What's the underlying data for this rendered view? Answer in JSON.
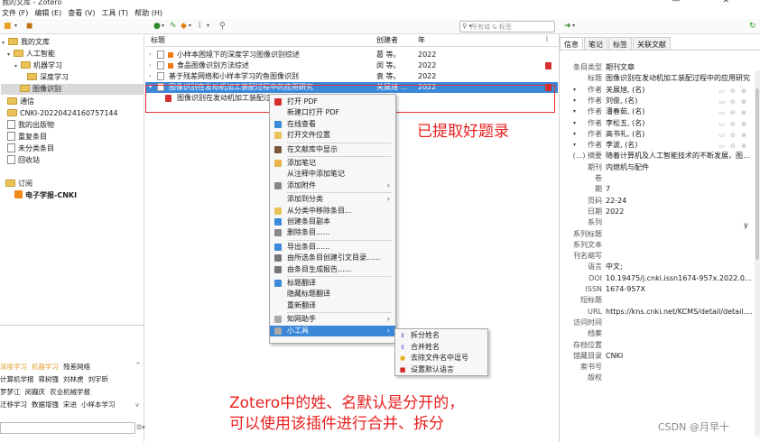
{
  "window": {
    "title": "我的文库 - Zotero",
    "controls": "— ✕"
  },
  "menubar": [
    "文件 (F)",
    "编辑 (E)",
    "查看 (V)",
    "工具 (T)",
    "帮助 (H)"
  ],
  "search": {
    "placeholder": "所有域 & 标签"
  },
  "left": {
    "library": "我的文库",
    "folders": [
      {
        "label": "人工智能"
      },
      {
        "label": "机器学习"
      },
      {
        "label": "深度学习"
      },
      {
        "label": "图像识别"
      }
    ],
    "others": [
      "通信",
      "CNKI-20220424160757144",
      "我的出版物",
      "重复条目",
      "未分类条目",
      "回收站"
    ],
    "feeds_title": "订阅",
    "feed": "电子学报-CNKI",
    "tags": [
      [
        "深度学习",
        "机器学习",
        "残差网络"
      ],
      [
        "计算机学报",
        "蒋树强",
        "刘林虎",
        "刘宇昕"
      ],
      [
        "罗梦江",
        "闵巍庆",
        "农业机械学报"
      ],
      [
        "迁移学习",
        "数据增强",
        "宋进",
        "小样本学习"
      ]
    ]
  },
  "items": {
    "columns": {
      "title": "标题",
      "creator": "创建者",
      "year": "年"
    },
    "rows": [
      {
        "title": "小样本困境下的深度学习图像识别综述",
        "creator": "葛 等。",
        "year": "2022"
      },
      {
        "title": "食品图像识别方法综述",
        "creator": "闵 等。",
        "year": "2022"
      },
      {
        "title": "基于残差网络和小样本学习的鱼图像识别",
        "creator": "袁 等。",
        "year": "2022"
      },
      {
        "title": "图像识别在发动机加工装配过程中的应用研究",
        "creator": "关展旭 ...",
        "year": "2022"
      },
      {
        "title": "图像识别在发动机加工装配过",
        "creator": "",
        "year": ""
      }
    ]
  },
  "info": {
    "tabs": [
      "信息",
      "笔记",
      "标签",
      "关联文献"
    ],
    "fields": [
      {
        "label": "条目类型",
        "value": "期刊文章"
      },
      {
        "label": "标题",
        "value": "图像识别在发动机加工装配过程中的应用研究"
      },
      {
        "label": "作者",
        "value": "关展旭, (名)"
      },
      {
        "label": "作者",
        "value": "刘俊, (名)"
      },
      {
        "label": "作者",
        "value": "潘春茹, (名)"
      },
      {
        "label": "作者",
        "value": "李松五, (名)"
      },
      {
        "label": "作者",
        "value": "高书礼, (名)"
      },
      {
        "label": "作者",
        "value": "李波, (名)"
      },
      {
        "label": "(...) 摘要",
        "value": "随着计算机及人工智能技术的不断发展，图..."
      },
      {
        "label": "期刊",
        "value": "内燃机与配件"
      },
      {
        "label": "卷",
        "value": ""
      },
      {
        "label": "期",
        "value": "7"
      },
      {
        "label": "页码",
        "value": "22-24"
      },
      {
        "label": "日期",
        "value": "2022"
      },
      {
        "label": "系列",
        "value": ""
      },
      {
        "label": "系列标题",
        "value": ""
      },
      {
        "label": "系列文本",
        "value": ""
      },
      {
        "label": "刊名缩写",
        "value": ""
      },
      {
        "label": "语言",
        "value": "中文;"
      },
      {
        "label": "DOI",
        "value": "10.19475/j.cnki.issn1674-957x.2022.07.0..."
      },
      {
        "label": "ISSN",
        "value": "1674-957X"
      },
      {
        "label": "短标题",
        "value": ""
      },
      {
        "label": "URL",
        "value": "https://kns.cnki.net/KCMS/detail/detail...."
      },
      {
        "label": "访问时间",
        "value": ""
      },
      {
        "label": "档案",
        "value": ""
      },
      {
        "label": "存档位置",
        "value": ""
      },
      {
        "label": "馆藏目录",
        "value": "CNKI"
      },
      {
        "label": "索书号",
        "value": ""
      },
      {
        "label": "版权",
        "value": ""
      }
    ],
    "date_side": "y"
  },
  "context_menu": [
    {
      "label": "打开 PDF",
      "icon": "pdf-icon",
      "color": "#d32f2f",
      "sep_before": false,
      "arrow": false
    },
    {
      "label": "新建口打开 PDF",
      "icon": "",
      "color": "",
      "sep_before": false,
      "arrow": false
    },
    {
      "label": "在线查看",
      "icon": "globe-icon",
      "color": "#3b8ad8",
      "sep_before": false,
      "arrow": false
    },
    {
      "label": "打开文件位置",
      "icon": "folder-icon",
      "color": "#e9c35a",
      "sep_before": false,
      "arrow": false
    },
    {
      "label": "在文献库中显示",
      "icon": "library-icon",
      "color": "#7a5a3a",
      "sep_before": true,
      "arrow": false
    },
    {
      "label": "添加笔记",
      "icon": "note-icon",
      "color": "#e9b24a",
      "sep_before": true,
      "arrow": false
    },
    {
      "label": "从注释中添加笔记",
      "icon": "",
      "color": "",
      "sep_before": false,
      "arrow": false
    },
    {
      "label": "添加附件",
      "icon": "paperclip-icon",
      "color": "#888888",
      "sep_before": false,
      "arrow": true
    },
    {
      "label": "添加到分类",
      "icon": "",
      "color": "",
      "sep_before": true,
      "arrow": true
    },
    {
      "label": "从分类中移除条目...",
      "icon": "folder-remove-icon",
      "color": "#e9c35a",
      "sep_before": false,
      "arrow": false
    },
    {
      "label": "创建条目副本",
      "icon": "copy-icon",
      "color": "#3b8ad8",
      "sep_before": false,
      "arrow": false
    },
    {
      "label": "删除条目......",
      "icon": "trash-icon",
      "color": "#888888",
      "sep_before": false,
      "arrow": false
    },
    {
      "label": "导出条目......",
      "icon": "export-icon",
      "color": "#3b8ad8",
      "sep_before": true,
      "arrow": false
    },
    {
      "label": "由所选条目创建引文目录......",
      "icon": "citation-icon",
      "color": "#777777",
      "sep_before": false,
      "arrow": false
    },
    {
      "label": "由条目生成报告......",
      "icon": "report-icon",
      "color": "#777777",
      "sep_before": false,
      "arrow": false
    },
    {
      "label": "标题翻译",
      "icon": "translate-icon",
      "color": "#3b8ad8",
      "sep_before": true,
      "arrow": false
    },
    {
      "label": "隐藏标题翻译",
      "icon": "",
      "color": "",
      "sep_before": false,
      "arrow": false
    },
    {
      "label": "重新翻译",
      "icon": "",
      "color": "",
      "sep_before": false,
      "arrow": false
    },
    {
      "label": "知网助手",
      "icon": "wrench-icon",
      "color": "#aaaaaa",
      "sep_before": true,
      "arrow": true
    },
    {
      "label": "小工具",
      "icon": "tool-icon",
      "color": "#aaaaaa",
      "sep_before": false,
      "arrow": true
    }
  ],
  "submenu": [
    {
      "label": "拆分姓名",
      "icon": "split-icon",
      "glyph": "‡",
      "color": "#4a4ad8"
    },
    {
      "label": "合并姓名",
      "icon": "merge-icon",
      "glyph": "‡",
      "color": "#4a4ad8"
    },
    {
      "label": "去除文件名中逗号",
      "icon": "dot-icon",
      "glyph": "●",
      "color": "#e8b020"
    },
    {
      "label": "设置默认语言",
      "icon": "flag-icon",
      "glyph": "■",
      "color": "#d32020"
    }
  ],
  "annotations": {
    "main": "已提取好题录",
    "bottom1": "Zotero中的姓、名默认是分开的，",
    "bottom2": "可以使用该插件进行合并、拆分",
    "watermark": "CSDN @月早十"
  },
  "colors": {
    "selection": "#3b87d8",
    "annotation": "#e82020"
  }
}
